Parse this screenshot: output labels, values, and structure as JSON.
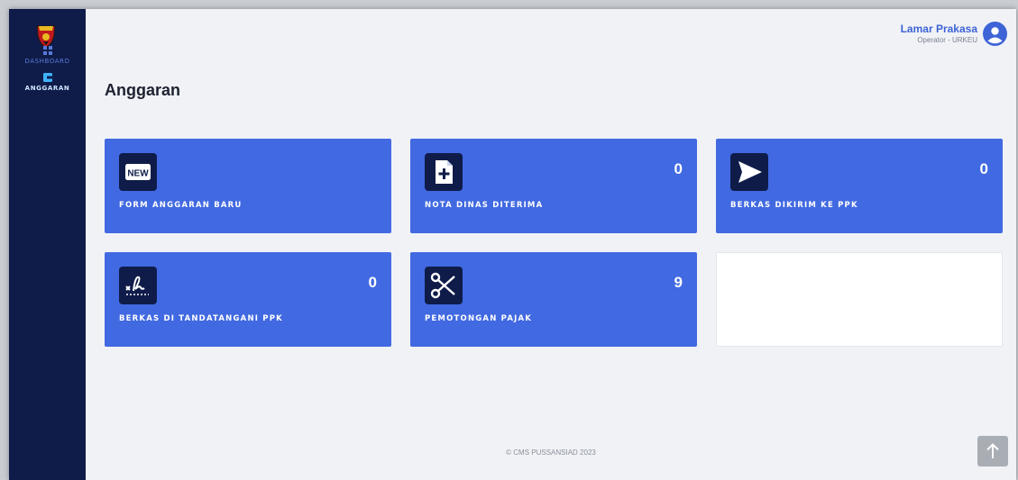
{
  "sidebar": {
    "items": [
      {
        "label": "DASHBOARD",
        "icon": "dashboard-grid-icon"
      },
      {
        "label": "ANGGARAN",
        "icon": "wallet-icon",
        "active": true
      }
    ]
  },
  "header": {
    "user_name": "Lamar Prakasa",
    "user_role": "Operator - URKEU"
  },
  "page": {
    "title": "Anggaran"
  },
  "cards": [
    {
      "label": "FORM ANGGARAN BARU",
      "count": "",
      "icon": "new-badge-icon"
    },
    {
      "label": "NOTA DINAS DITERIMA",
      "count": "0",
      "icon": "file-plus-icon"
    },
    {
      "label": "BERKAS DIKIRIM KE PPK",
      "count": "0",
      "icon": "send-icon"
    },
    {
      "label": "BERKAS DI TANDATANGANI PPK",
      "count": "0",
      "icon": "signature-icon"
    },
    {
      "label": "PEMOTONGAN PAJAK",
      "count": "9",
      "icon": "scissors-icon"
    }
  ],
  "footer": {
    "text": "© CMS PUSSANSIAD 2023"
  },
  "colors": {
    "sidebar": "#0f1c4a",
    "card": "#4169e1",
    "accent": "#3d63d6",
    "background": "#f0f2f6"
  }
}
